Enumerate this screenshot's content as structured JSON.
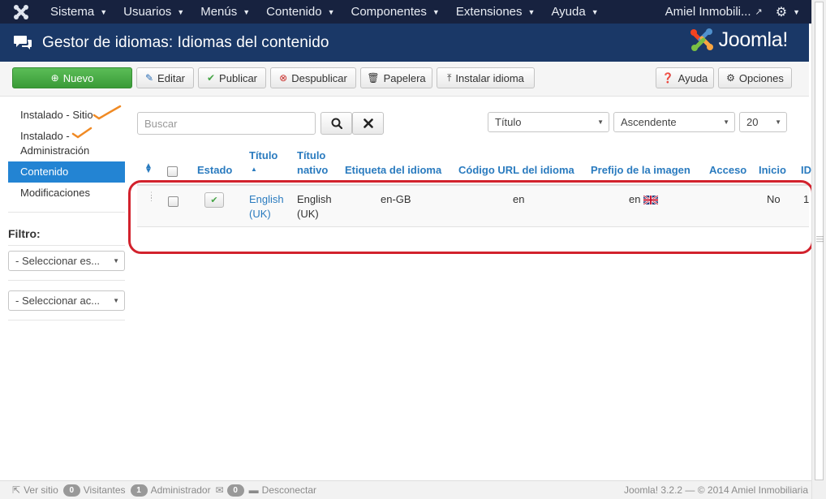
{
  "topnav": {
    "items": [
      {
        "label": "Sistema"
      },
      {
        "label": "Usuarios"
      },
      {
        "label": "Menús"
      },
      {
        "label": "Contenido"
      },
      {
        "label": "Componentes"
      },
      {
        "label": "Extensiones"
      },
      {
        "label": "Ayuda"
      }
    ],
    "user": "Amiel Inmobili..."
  },
  "header": {
    "title": "Gestor de idiomas: Idiomas del contenido",
    "brand": "Joomla!"
  },
  "toolbar": {
    "nuevo": "Nuevo",
    "editar": "Editar",
    "publicar": "Publicar",
    "despublicar": "Despublicar",
    "papelera": "Papelera",
    "instalar": "Instalar idioma",
    "ayuda": "Ayuda",
    "opciones": "Opciones"
  },
  "sidebar": {
    "links": [
      {
        "label": "Instalado - Sitio"
      },
      {
        "label": "Instalado - Administración"
      },
      {
        "label": "Contenido"
      },
      {
        "label": "Modificaciones"
      }
    ],
    "filter_title": "Filtro:",
    "filters": [
      {
        "label": "- Seleccionar es..."
      },
      {
        "label": "- Seleccionar ac..."
      }
    ]
  },
  "search": {
    "placeholder": "Buscar"
  },
  "sort": {
    "field": "Título",
    "direction": "Ascendente",
    "limit": "20"
  },
  "table": {
    "headers": {
      "estado": "Estado",
      "titulo": "Título",
      "titulo_nativo": "Título nativo",
      "etiqueta": "Etiqueta del idioma",
      "codigo": "Código URL del idioma",
      "prefijo": "Prefijo de la imagen",
      "acceso": "Acceso",
      "inicio": "Inicio",
      "id": "ID"
    },
    "rows": [
      {
        "titulo": "English (UK)",
        "titulo_nativo": "English (UK)",
        "etiqueta": "en-GB",
        "codigo": "en",
        "prefijo": "en",
        "acceso": "",
        "inicio": "No",
        "id": "1"
      }
    ]
  },
  "footer": {
    "ver_sitio": "Ver sitio",
    "visitantes_count": "0",
    "visitantes": "Visitantes",
    "admin_count": "1",
    "admin": "Administrador",
    "mail_count": "0",
    "desconectar": "Desconectar",
    "copyright": "Joomla! 3.2.2 — © 2014 Amiel Inmobiliaria"
  },
  "colors": {
    "topnav": "#17223f",
    "header": "#1a3867",
    "accent": "#2384d3",
    "highlight": "#d2222d",
    "green": "#46a546"
  }
}
